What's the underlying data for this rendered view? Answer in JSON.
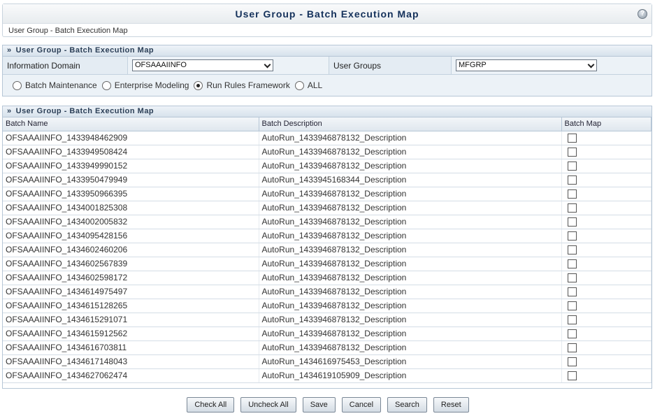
{
  "page": {
    "title": "User Group - Batch Execution Map",
    "breadcrumb": "User Group - Batch Execution Map",
    "help_icon": "help-icon"
  },
  "filter": {
    "header": "User Group - Batch Execution Map",
    "info_domain_label": "Information Domain",
    "info_domain_value": "OFSAAAIINFO",
    "user_groups_label": "User Groups",
    "user_groups_value": "MFGRP",
    "radios": [
      {
        "label": "Batch Maintenance",
        "selected": false
      },
      {
        "label": "Enterprise Modeling",
        "selected": false
      },
      {
        "label": "Run Rules Framework",
        "selected": true
      },
      {
        "label": "ALL",
        "selected": false
      }
    ]
  },
  "grid": {
    "header": "User Group - Batch Execution Map",
    "columns": [
      "Batch Name",
      "Batch Description",
      "Batch Map"
    ],
    "rows": [
      {
        "name": "OFSAAAIINFO_1433948462909",
        "desc": "AutoRun_1433946878132_Description",
        "mapped": false
      },
      {
        "name": "OFSAAAIINFO_1433949508424",
        "desc": "AutoRun_1433946878132_Description",
        "mapped": false
      },
      {
        "name": "OFSAAAIINFO_1433949990152",
        "desc": "AutoRun_1433946878132_Description",
        "mapped": false
      },
      {
        "name": "OFSAAAIINFO_1433950479949",
        "desc": "AutoRun_1433945168344_Description",
        "mapped": false
      },
      {
        "name": "OFSAAAIINFO_1433950966395",
        "desc": "AutoRun_1433946878132_Description",
        "mapped": false
      },
      {
        "name": "OFSAAAIINFO_1434001825308",
        "desc": "AutoRun_1433946878132_Description",
        "mapped": false
      },
      {
        "name": "OFSAAAIINFO_1434002005832",
        "desc": "AutoRun_1433946878132_Description",
        "mapped": false
      },
      {
        "name": "OFSAAAIINFO_1434095428156",
        "desc": "AutoRun_1433946878132_Description",
        "mapped": false
      },
      {
        "name": "OFSAAAIINFO_1434602460206",
        "desc": "AutoRun_1433946878132_Description",
        "mapped": false
      },
      {
        "name": "OFSAAAIINFO_1434602567839",
        "desc": "AutoRun_1433946878132_Description",
        "mapped": false
      },
      {
        "name": "OFSAAAIINFO_1434602598172",
        "desc": "AutoRun_1433946878132_Description",
        "mapped": false
      },
      {
        "name": "OFSAAAIINFO_1434614975497",
        "desc": "AutoRun_1433946878132_Description",
        "mapped": false
      },
      {
        "name": "OFSAAAIINFO_1434615128265",
        "desc": "AutoRun_1433946878132_Description",
        "mapped": false
      },
      {
        "name": "OFSAAAIINFO_1434615291071",
        "desc": "AutoRun_1433946878132_Description",
        "mapped": false
      },
      {
        "name": "OFSAAAIINFO_1434615912562",
        "desc": "AutoRun_1433946878132_Description",
        "mapped": false
      },
      {
        "name": "OFSAAAIINFO_1434616703811",
        "desc": "AutoRun_1433946878132_Description",
        "mapped": false
      },
      {
        "name": "OFSAAAIINFO_1434617148043",
        "desc": "AutoRun_1434616975453_Description",
        "mapped": false
      },
      {
        "name": "OFSAAAIINFO_1434627062474",
        "desc": "AutoRun_1434619105909_Description",
        "mapped": false
      }
    ]
  },
  "buttons": {
    "check_all": "Check All",
    "uncheck_all": "Uncheck All",
    "save": "Save",
    "cancel": "Cancel",
    "search": "Search",
    "reset": "Reset"
  }
}
